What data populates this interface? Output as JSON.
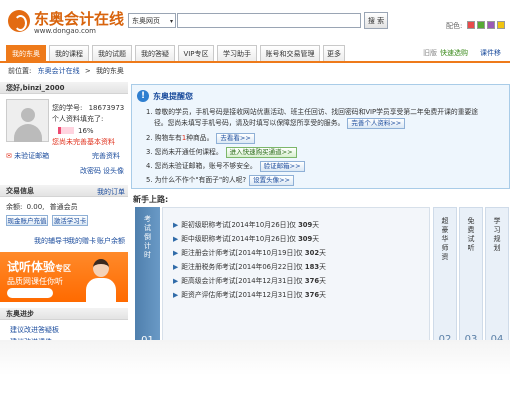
{
  "header": {
    "logo_text": "东奥会计在线",
    "logo_url": "www.dongao.com",
    "search_scope": "东奥网页",
    "search_button": "搜 索",
    "skin_label": "配色:",
    "skin_colors": [
      "#e84a4a",
      "#55aa33",
      "#9b59b6",
      "#f1c40f"
    ]
  },
  "nav": {
    "tabs": [
      "我的东奥",
      "我的课程",
      "我的试题",
      "我的答疑",
      "VIP专区",
      "学习助手",
      "账号和交易管理",
      "更多"
    ],
    "active_tab": "我的东奥",
    "old_version": "旧版",
    "quick_select": "快速选购",
    "cart": "课件移"
  },
  "breadcrumb": {
    "prefix": "前位置:",
    "home": "东奥会计在线",
    "sep": ">",
    "current": "我的东奥"
  },
  "user": {
    "greeting": "您好,binzi_2000",
    "student_id_label": "您的学号:",
    "student_id": "18673973",
    "profile_label": "个人资料填充了:",
    "profile_percent": "16%",
    "profile_fraction": 0.16,
    "profile_warning": "您尚未完善基本资料",
    "email_unverified": "未验证邮箱",
    "complete_profile": "完善资料",
    "change_password": "改密码",
    "set_avatar": "设头像"
  },
  "transaction": {
    "header": "交易信息",
    "my_orders": "我的订单",
    "balance_label": "余额:",
    "balance": "0.00,",
    "member_level": "普通会员",
    "recharge": "现金账户充值",
    "activate_card": "激活学习卡",
    "links": [
      "我的辅导书",
      "我的赠卡",
      "账户余额"
    ]
  },
  "promo": {
    "title": "试听体验",
    "title_suffix": "专区",
    "subtitle": "品质网课任你听"
  },
  "progress": {
    "header": "东奥进步",
    "items": [
      "建议改进答疑板",
      "建议改进课件"
    ]
  },
  "notice": {
    "title": "东奥提醒您",
    "lines": [
      {
        "num": "1.",
        "text": "尊敬的学员，手机号码是接收网站优惠活动、班主任回访、找回密码和VIP学员享受第二年免费开课的重要途",
        "text2": "径。您尚未填写手机号码，请及时填写以保障您所享受的服务。",
        "button": "完善个人资料>>"
      },
      {
        "num": "2.",
        "text": "购物车有",
        "highlight": "1",
        "text_after": "种商品。",
        "button": "去看看>>"
      },
      {
        "num": "3.",
        "text": "您尚未开通任何课程。",
        "button": "进入快速购买通道>>"
      },
      {
        "num": "4.",
        "text": "您尚未验证邮箱，账号不够安全。",
        "button": "验证邮箱>>"
      },
      {
        "num": "5.",
        "text": "为什么不作个\"有面子\"的人呢?",
        "button": "设置头像>>"
      }
    ]
  },
  "road": {
    "title": "新手上路:",
    "left_label": "考试倒计时",
    "left_num": "01",
    "exams": [
      {
        "name": "距初级职称考试[2014年10月26日]仅",
        "days": "309",
        "unit": "天"
      },
      {
        "name": "距中级职称考试[2014年10月26日]仅",
        "days": "309",
        "unit": "天"
      },
      {
        "name": "距注册会计师考试[2014年10月19日]仅",
        "days": "302",
        "unit": "天"
      },
      {
        "name": "距注册税务师考试[2014年06月22日]仅",
        "days": "183",
        "unit": "天"
      },
      {
        "name": "距高级会计师考试[2014年12月31日]仅",
        "days": "376",
        "unit": "天"
      },
      {
        "name": "距资产评估师考试[2014年12月31日]仅",
        "days": "376",
        "unit": "天"
      }
    ],
    "columns": [
      {
        "label": "超豪华师资",
        "num": "02"
      },
      {
        "label": "免费试听",
        "num": "03"
      },
      {
        "label": "学习规划",
        "num": "04"
      }
    ]
  }
}
